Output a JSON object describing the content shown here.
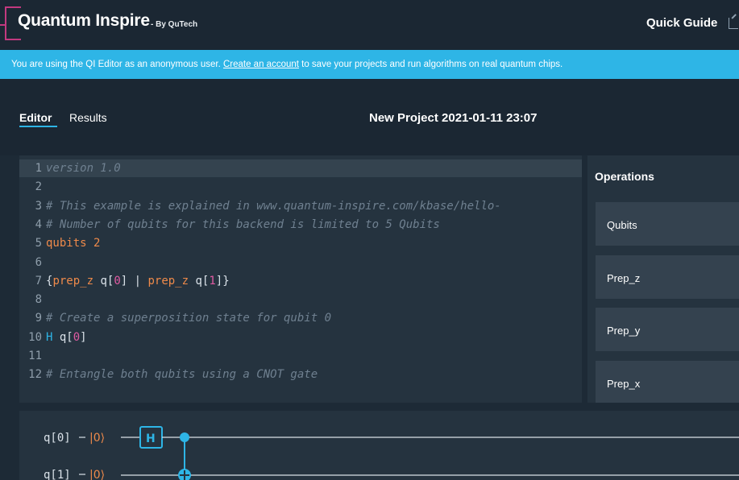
{
  "header": {
    "logo_title": "Quantum Inspire",
    "logo_by": "- By QuTech",
    "quick_guide": "Quick Guide"
  },
  "banner": {
    "prefix": "You are using the QI Editor as an anonymous user. ",
    "link": "Create an account",
    "suffix": " to save your projects and run algorithms on real quantum chips."
  },
  "tabs": {
    "editor": "Editor",
    "results": "Results",
    "project_title": "New Project 2021-01-11 23:07"
  },
  "code_lines": [
    {
      "n": "1",
      "parts": [
        {
          "t": "version 1.0",
          "c": "cmt"
        }
      ]
    },
    {
      "n": "2",
      "parts": []
    },
    {
      "n": "3",
      "parts": [
        {
          "t": "# This example is explained in www.quantum-inspire.com/kbase/hello-",
          "c": "cmt"
        }
      ]
    },
    {
      "n": "4",
      "parts": [
        {
          "t": "# Number of qubits for this backend is limited to 5 Qubits",
          "c": "cmt"
        }
      ]
    },
    {
      "n": "5",
      "parts": [
        {
          "t": "qubits ",
          "c": "kw"
        },
        {
          "t": "2",
          "c": "kw"
        }
      ]
    },
    {
      "n": "6",
      "parts": []
    },
    {
      "n": "7",
      "parts": [
        {
          "t": "{",
          "c": "txt"
        },
        {
          "t": "prep_z",
          "c": "kw"
        },
        {
          "t": " q[",
          "c": "txt"
        },
        {
          "t": "0",
          "c": "num"
        },
        {
          "t": "] | ",
          "c": "txt"
        },
        {
          "t": "prep_z",
          "c": "kw"
        },
        {
          "t": " q[",
          "c": "txt"
        },
        {
          "t": "1",
          "c": "num"
        },
        {
          "t": "]}",
          "c": "txt"
        }
      ]
    },
    {
      "n": "8",
      "parts": []
    },
    {
      "n": "9",
      "parts": [
        {
          "t": "# Create a superposition state for qubit 0",
          "c": "cmt"
        }
      ]
    },
    {
      "n": "10",
      "parts": [
        {
          "t": "H",
          "c": "hg"
        },
        {
          "t": " q[",
          "c": "txt"
        },
        {
          "t": "0",
          "c": "num"
        },
        {
          "t": "]",
          "c": "txt"
        }
      ]
    },
    {
      "n": "11",
      "parts": []
    },
    {
      "n": "12",
      "parts": [
        {
          "t": "# Entangle both qubits using a CNOT gate",
          "c": "cmt"
        }
      ]
    }
  ],
  "operations": {
    "title": "Operations",
    "items": [
      "Qubits",
      "Prep_z",
      "Prep_y",
      "Prep_x"
    ]
  },
  "circuit": {
    "qubits": [
      {
        "label": "q[0]",
        "init": "|0⟩",
        "gates": [
          "H",
          "CNOT-control"
        ]
      },
      {
        "label": "q[1]",
        "init": "|0⟩",
        "gates": [
          "CNOT-target"
        ]
      }
    ]
  },
  "colors": {
    "accent": "#2eb5e6",
    "brand": "#c2397f",
    "keyword": "#ef8a4a",
    "number": "#e05aa2",
    "background": "#1b2733",
    "panel": "#25333f"
  }
}
